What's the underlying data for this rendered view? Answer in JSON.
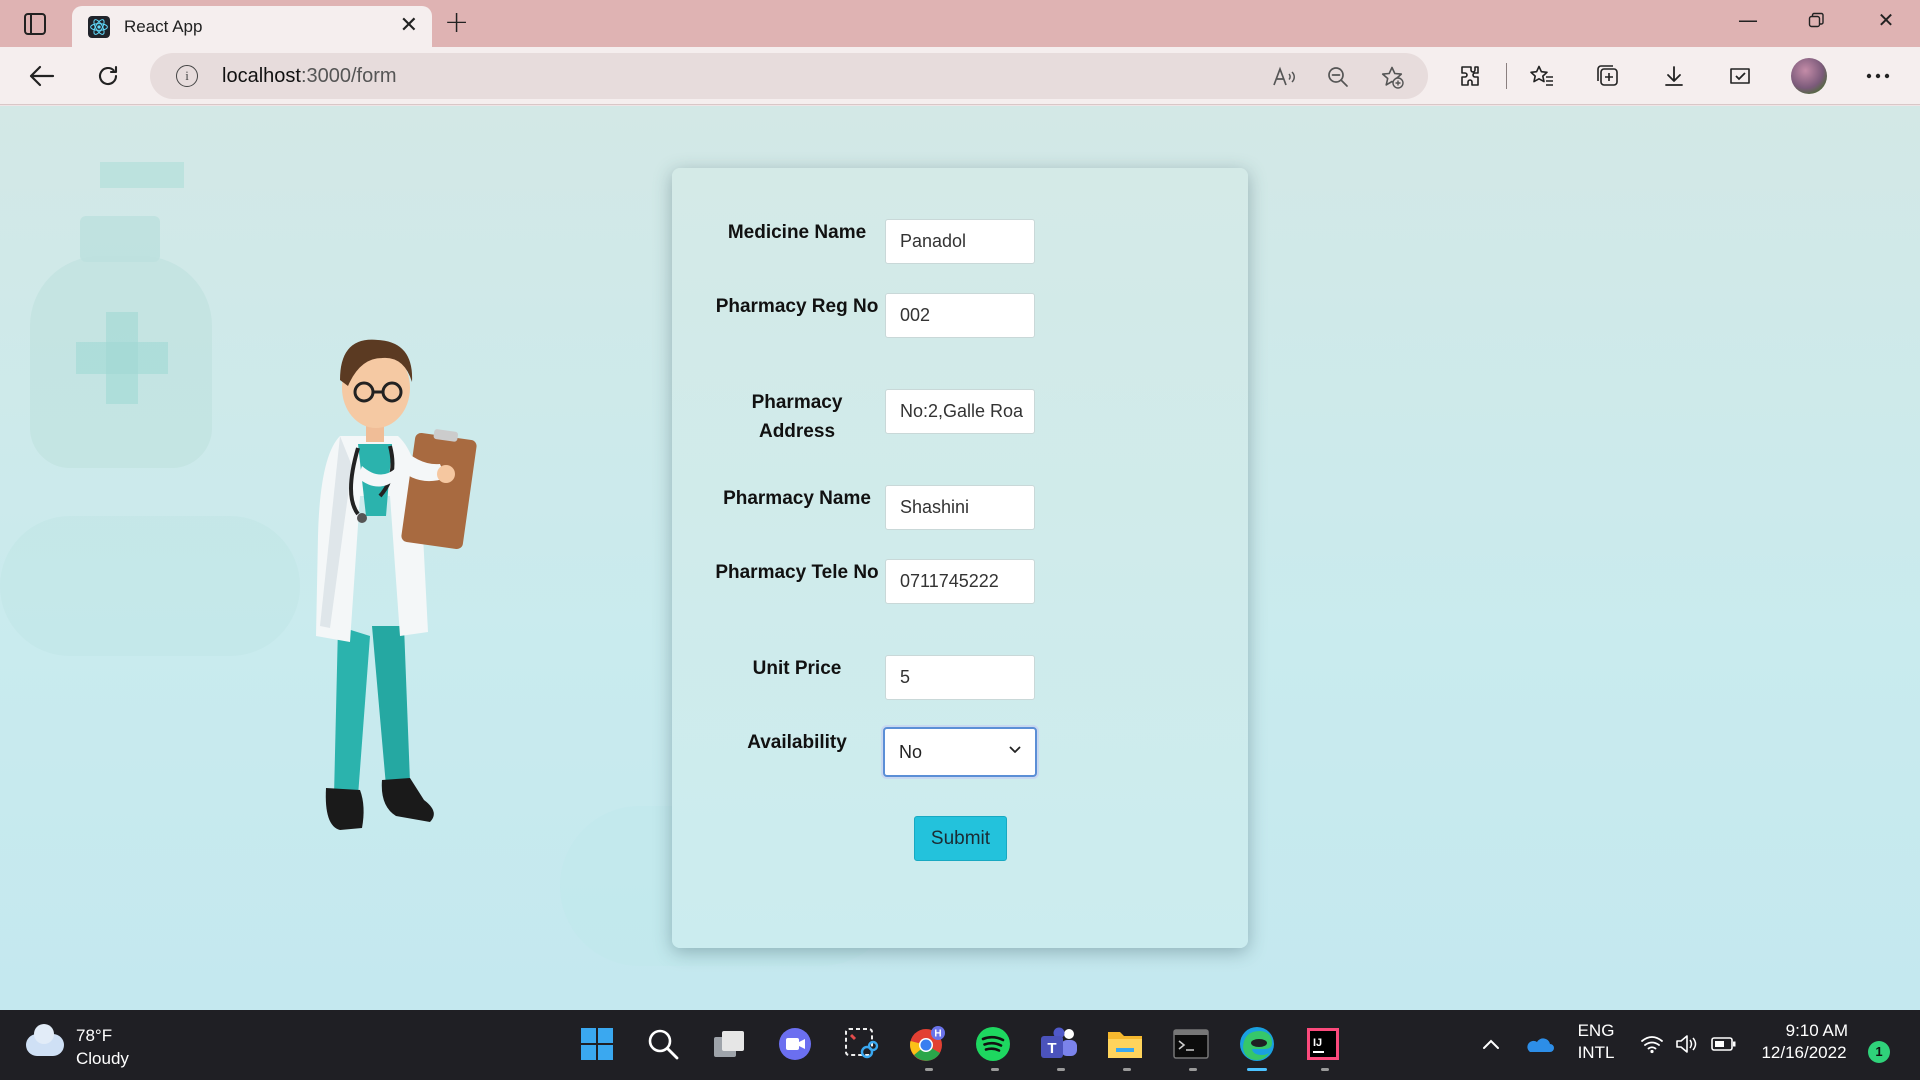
{
  "browser": {
    "tab_title": "React App",
    "url_host": "localhost",
    "url_path": ":3000/form",
    "icons": [
      "tab-actions-icon",
      "react-logo-icon",
      "close-icon",
      "new-tab-icon",
      "minimize-icon",
      "restore-icon",
      "close-window-icon",
      "back-icon",
      "refresh-icon",
      "site-info-icon",
      "read-aloud-icon",
      "zoom-out-icon",
      "add-favorite-icon",
      "extensions-icon",
      "favorites-icon",
      "collections-icon",
      "downloads-icon",
      "browser-essentials-icon",
      "profile-avatar",
      "more-icon"
    ]
  },
  "form": {
    "fields": [
      {
        "label": "Medicine Name",
        "value": "Panadol"
      },
      {
        "label": "Pharmacy Reg No",
        "value": "002"
      },
      {
        "label": "Pharmacy Address",
        "value": "No:2,Galle Roa"
      },
      {
        "label": "Pharmacy Name",
        "value": "Shashini"
      },
      {
        "label": "Pharmacy Tele No",
        "value": "0711745222"
      },
      {
        "label": "Unit Price",
        "value": "5"
      }
    ],
    "availability_label": "Availability",
    "availability_value": "No",
    "submit_label": "Submit"
  },
  "taskbar": {
    "weather_temp": "78°F",
    "weather_condition": "Cloudy",
    "language_line1": "ENG",
    "language_line2": "INTL",
    "time": "9:10 AM",
    "date": "12/16/2022",
    "notification_count": "1",
    "chrome_badge": "H",
    "apps": [
      "start-icon",
      "search-icon",
      "task-view-icon",
      "chat-icon",
      "snipping-tool-icon",
      "chrome-icon",
      "spotify-icon",
      "teams-icon",
      "file-explorer-icon",
      "terminal-icon",
      "edge-icon",
      "intellij-icon"
    ]
  },
  "colors": {
    "tabbar": "#dfb3b3",
    "page_bg": "#c9ebee",
    "submit_button": "#23c2dc",
    "taskbar": "#1f1f24"
  }
}
